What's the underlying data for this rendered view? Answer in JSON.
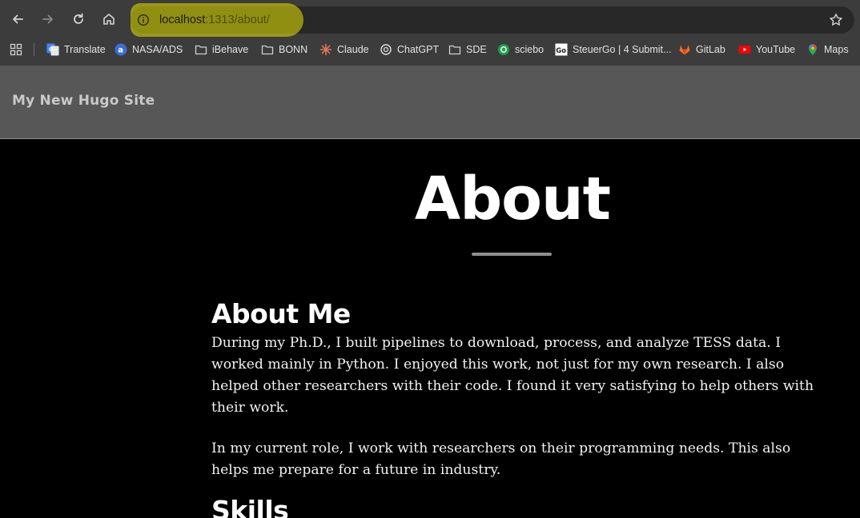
{
  "browser": {
    "url_host": "localhost",
    "url_path": ":1313/about/",
    "bookmarks": [
      {
        "label": "Translate",
        "icon": "google-translate-icon"
      },
      {
        "label": "NASA/ADS",
        "icon": "ads-icon"
      },
      {
        "label": "iBehave",
        "icon": "folder-icon"
      },
      {
        "label": "BONN",
        "icon": "folder-icon"
      },
      {
        "label": "Claude",
        "icon": "claude-icon"
      },
      {
        "label": "ChatGPT",
        "icon": "chatgpt-icon"
      },
      {
        "label": "SDE",
        "icon": "folder-icon"
      },
      {
        "label": "sciebo",
        "icon": "sciebo-icon"
      },
      {
        "label": "SteuerGo | 4 Submit...",
        "icon": "steuergo-icon"
      },
      {
        "label": "GitLab",
        "icon": "gitlab-icon"
      },
      {
        "label": "YouTube",
        "icon": "youtube-icon"
      },
      {
        "label": "Maps",
        "icon": "maps-icon"
      }
    ],
    "colors": {
      "url_highlight": "#e8e400",
      "chrome_bg": "#3c3c3c"
    }
  },
  "site": {
    "title": "My New Hugo Site"
  },
  "page": {
    "title": "About",
    "sections": [
      {
        "heading": "About Me",
        "paragraphs": [
          "During my Ph.D., I built pipelines to download, process, and analyze TESS data. I worked mainly in Python. I enjoyed this work, not just for my own research. I also helped other researchers with their code. I found it very satisfying to help others with their work.",
          "In my current role, I work with researchers on their programming needs. This also helps me prepare for a future in industry."
        ]
      },
      {
        "heading": "Skills"
      }
    ]
  }
}
